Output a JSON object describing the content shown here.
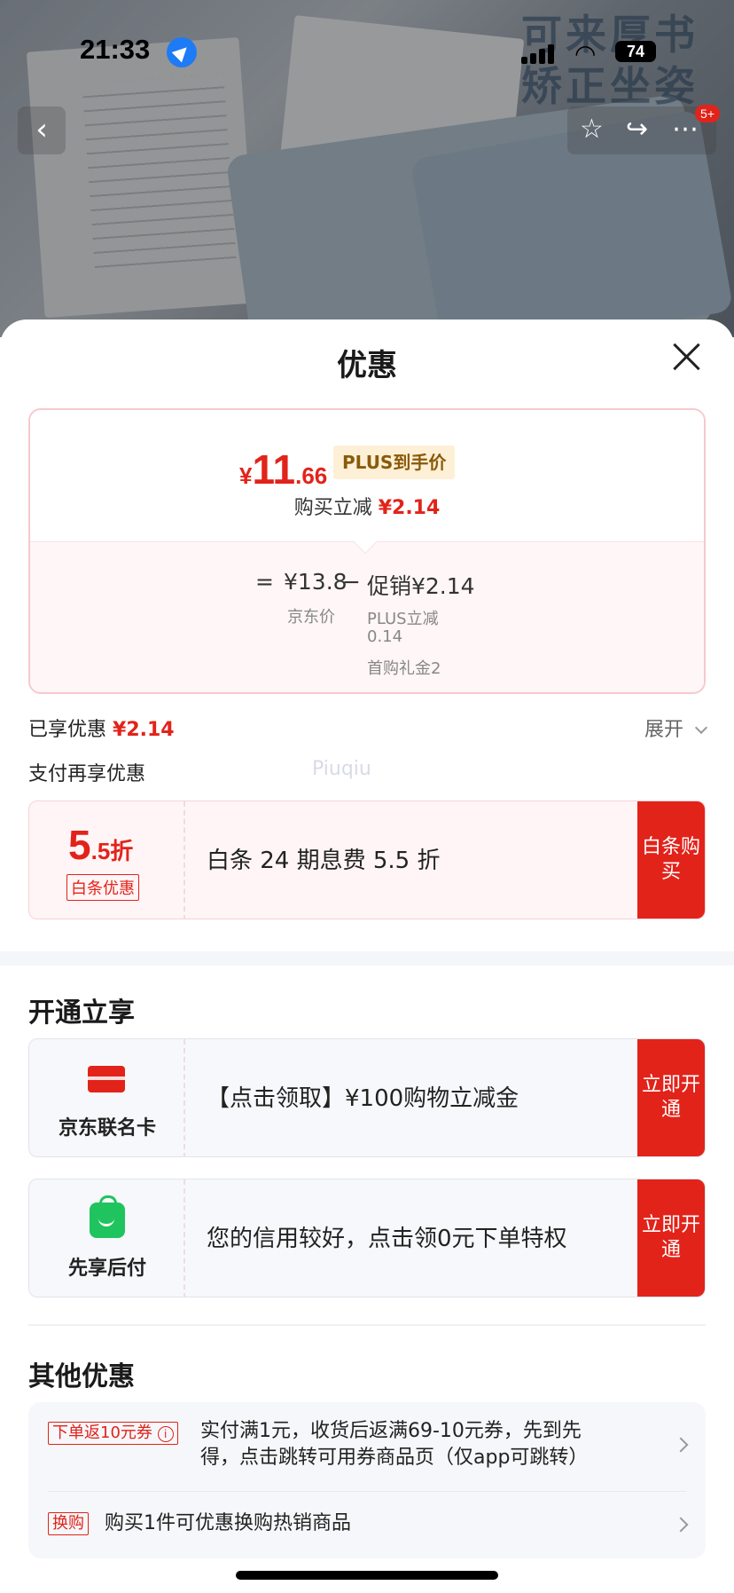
{
  "status_bar": {
    "time": "21:33",
    "battery": "74"
  },
  "background": {
    "decor_text": "可来厚书\n矫正坐姿"
  },
  "nav": {
    "notification_count": "5+"
  },
  "sheet": {
    "title": "优惠",
    "price": {
      "currency": "¥",
      "integer": "11",
      "decimal": ".66",
      "tag": "PLUS到手价",
      "direct_cut_label": "购买立减",
      "direct_cut_value": "¥2.14"
    },
    "calc": {
      "eq": "=",
      "base_price": "¥13.8",
      "base_label": "京东价",
      "minus": "−",
      "promo": "促销¥2.14",
      "promo_detail_1": "PLUS立减",
      "promo_detail_2": "0.14",
      "promo_detail_3": "首购礼金2"
    },
    "enjoyed_label": "已享优惠",
    "enjoyed_value": "¥2.14",
    "expand_label": "展开",
    "pay_more_label": "支付再享优惠",
    "watermark": "Piuqiu",
    "baitiao": {
      "discount_big": "5",
      "discount_small": ".5折",
      "tag": "白条优惠",
      "desc": "白条 24 期息费 5.5 折",
      "action": "白条购买"
    },
    "open_section": {
      "title": "开通立享",
      "items": [
        {
          "label": "京东联名卡",
          "desc": "【点击领取】¥100购物立减金",
          "action": "立即开通"
        },
        {
          "label": "先享后付",
          "desc": "您的信用较好，点击领0元下单特权",
          "action": "立即开通"
        }
      ]
    },
    "other_section": {
      "title": "其他优惠",
      "items": [
        {
          "tag": "下单返10元券",
          "text_1": "实付满1元，收货后返满69-10元券，先到先",
          "text_2": "得，点击跳转可用券商品页（仅app可跳转）"
        },
        {
          "tag": "换购",
          "text_1": "购买1件可优惠换购热销商品"
        }
      ]
    }
  },
  "colors": {
    "accent": "#e2231a",
    "plus_tag_bg": "#fdf0d6",
    "green": "#1fc45e"
  },
  "icons": [
    "location-arrow-icon",
    "signal-icon",
    "wifi-icon",
    "battery-icon",
    "back-icon",
    "star-icon",
    "share-icon",
    "more-icon",
    "close-icon",
    "card-icon",
    "bag-icon",
    "info-icon",
    "chevron-right-icon",
    "chevron-down-icon"
  ]
}
